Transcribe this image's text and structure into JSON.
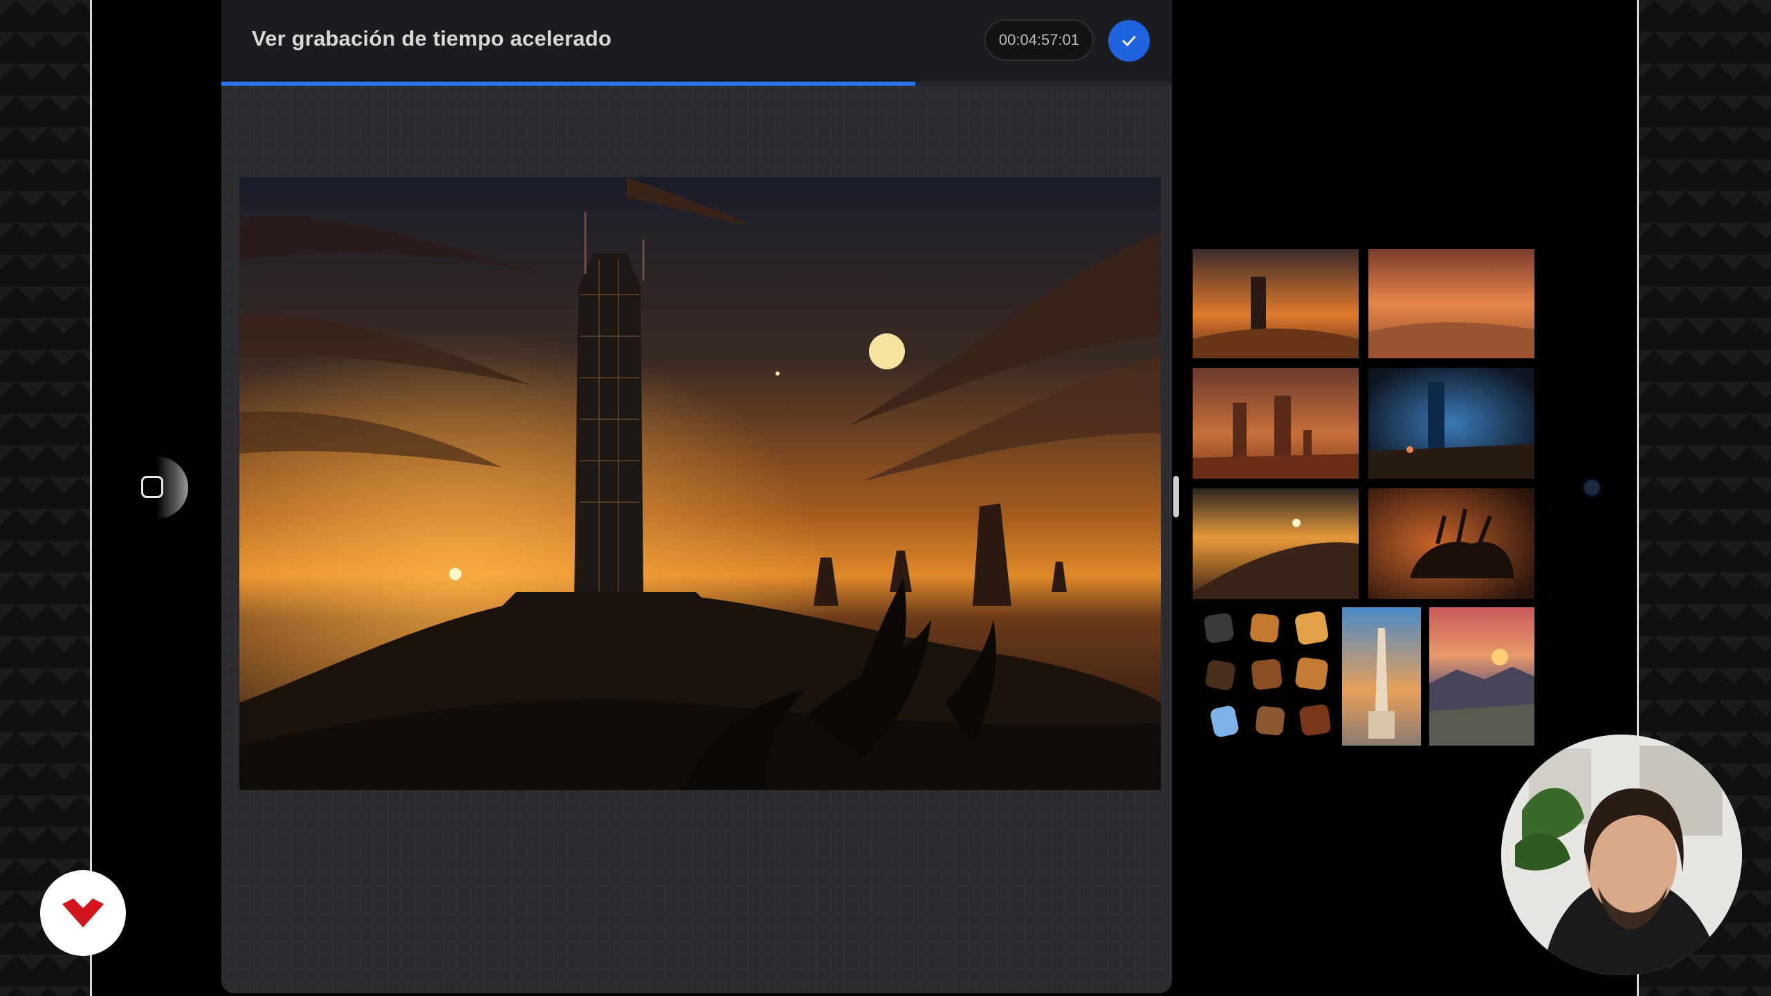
{
  "panel": {
    "title": "Ver grabación de tiempo acelerado",
    "timer": "00:04:57:01",
    "progress": 0.73
  },
  "colors": {
    "accent": "#2b73e8",
    "done_button": "#1f63e0",
    "header_bg": "#1b1c1f",
    "canvas_bg": "#2a2b2e"
  },
  "icons": {
    "done": "checkmark-icon",
    "side": "square-icon",
    "logo": "brand-logo-icon"
  },
  "references": {
    "palette_swatches": [
      "#3a3a3a",
      "#c47a2e",
      "#e3a24a",
      "#4a2e1c",
      "#8a4e24",
      "#c27a34",
      "#7fb2e6",
      "#8a5830",
      "#7a3618"
    ]
  }
}
